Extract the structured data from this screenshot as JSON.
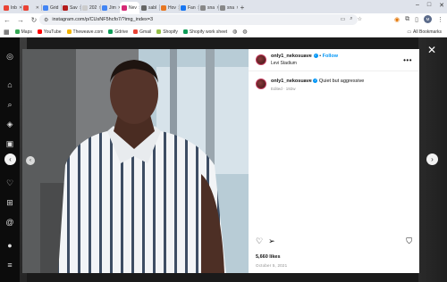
{
  "browser": {
    "tabs": [
      {
        "label": "Inb",
        "color": "#ea4335"
      },
      {
        "label": "",
        "color": "#ea4335"
      },
      {
        "label": "Grid",
        "color": "#4285f4"
      },
      {
        "label": "Sav",
        "color": "#b31b1b"
      },
      {
        "label": "202",
        "color": "#cccccc"
      },
      {
        "label": "Jim",
        "color": "#4285f4"
      },
      {
        "label": "Nev",
        "color": "#d62976",
        "active": true
      },
      {
        "label": "sabl",
        "color": "#666666"
      },
      {
        "label": "Hov",
        "color": "#e87722"
      },
      {
        "label": "Fan",
        "color": "#1877f2"
      },
      {
        "label": "sna",
        "color": "#888888"
      },
      {
        "label": "sna",
        "color": "#888888"
      }
    ],
    "url": "instagram.com/p/CUsNF5hcfo7/?img_index=3",
    "bookmarks": [
      {
        "label": "Maps",
        "color": "#34a853"
      },
      {
        "label": "YouTube",
        "color": "#ff0000"
      },
      {
        "label": "Theweave.com",
        "color": "#f4b400"
      },
      {
        "label": "Gdrive",
        "color": "#0f9d58"
      },
      {
        "label": "Gmail",
        "color": "#ea4335"
      },
      {
        "label": "Shopify",
        "color": "#95bf47"
      },
      {
        "label": "Shopify work sheet",
        "color": "#0f9d58"
      }
    ],
    "all_bookmarks": "All Bookmarks",
    "profile_initial": "M"
  },
  "post": {
    "username": "only1_nekosuave",
    "follow_label": "Follow",
    "location": "Levi Stadium",
    "caption": "Quiet but aggressive",
    "edited_label": "Edited",
    "edited_age": "192w",
    "likes": "5,660 likes",
    "date": "October 5, 2021"
  },
  "colors": {
    "accent": "#0095f6",
    "overlay": "#1a1a1a"
  }
}
